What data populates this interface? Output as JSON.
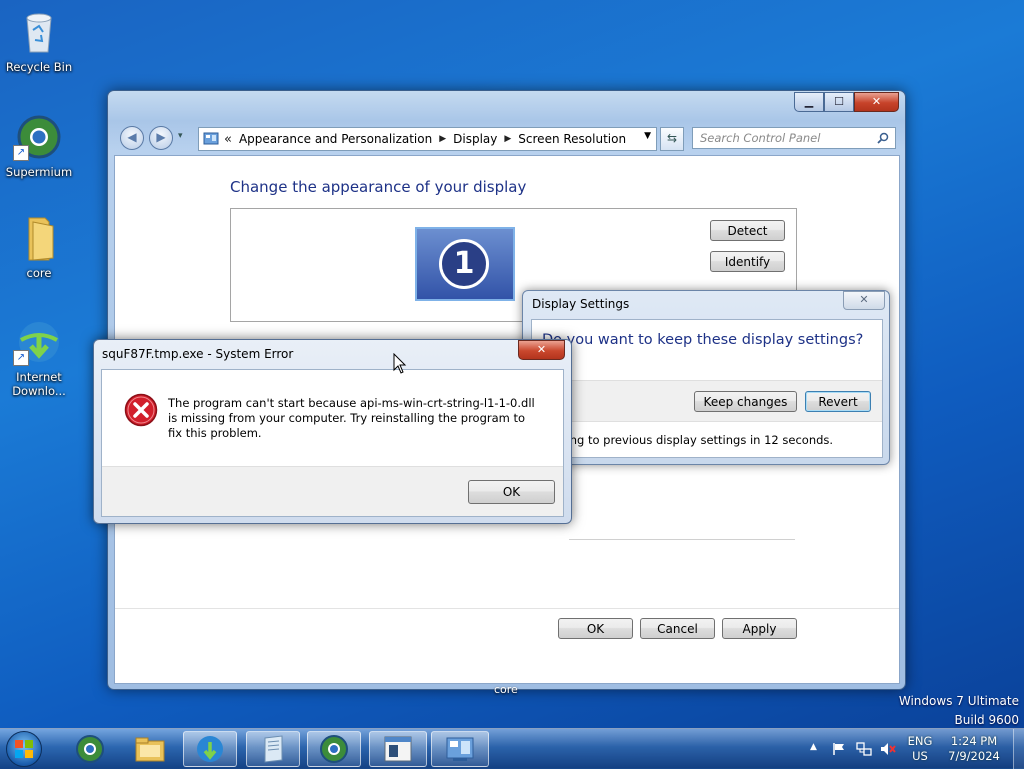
{
  "desktop": {
    "icons": [
      {
        "label": "Recycle Bin"
      },
      {
        "label": "Supermium"
      },
      {
        "label": "core"
      },
      {
        "label": "Internet Downlo..."
      }
    ],
    "stray_label": "core",
    "watermark": {
      "line1": "Windows 7 Ultimate",
      "line2": "Build 9600"
    }
  },
  "cp_window": {
    "breadcrumb": [
      "Appearance and Personalization",
      "Display",
      "Screen Resolution"
    ],
    "breadcrumb_prefix": "«",
    "search_placeholder": "Search Control Panel",
    "heading": "Change the appearance of your display",
    "monitor_number": "1",
    "detect_label": "Detect",
    "identify_label": "Identify",
    "ok_label": "OK",
    "cancel_label": "Cancel",
    "apply_label": "Apply"
  },
  "display_settings_dialog": {
    "title": "Display Settings",
    "question": "Do you want to keep these display settings?",
    "keep_label": "Keep changes",
    "revert_label": "Revert",
    "countdown_text": "ting to previous display settings in 12 seconds."
  },
  "error_dialog": {
    "title": "squF87F.tmp.exe - System Error",
    "message": "The program can't start because api-ms-win-crt-string-l1-1-0.dll is missing from your computer. Try reinstalling the program to fix this problem.",
    "ok_label": "OK"
  },
  "taskbar": {
    "language_line1": "ENG",
    "language_line2": "US",
    "time": "1:24 PM",
    "date": "7/9/2024"
  },
  "colors": {
    "heading_blue": "#1e3287",
    "error_red": "#d21f2b",
    "desktop_blue": "#1b7bd6"
  }
}
